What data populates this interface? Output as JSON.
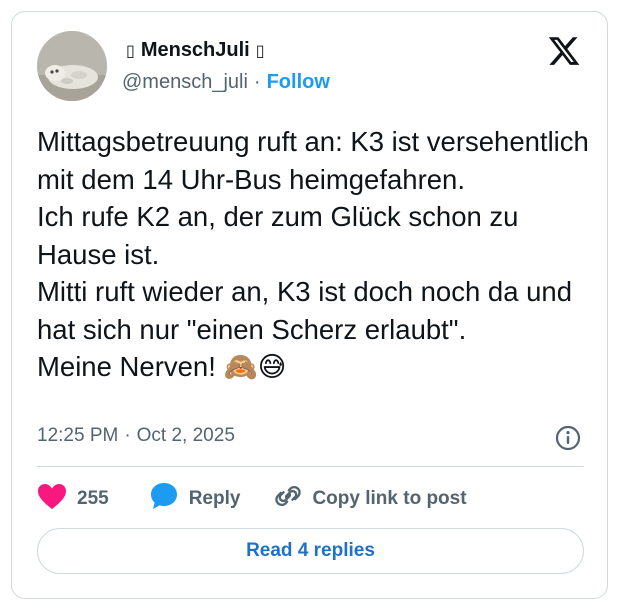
{
  "author": {
    "name": "MenschJuli",
    "name_prefix": "▯",
    "name_suffix": "▯",
    "handle": "@mensch_juli",
    "separator": "·",
    "follow_label": "Follow",
    "avatar": "seal-photo"
  },
  "brand": {
    "icon": "x-logo-icon"
  },
  "tweet": {
    "text": "Mittagsbetreuung ruft an: K3 ist versehentlich mit dem 14 Uhr-Bus heimgefahren.\nIch rufe K2 an, der zum Glück schon zu Hause ist.\nMitti ruft wieder an, K3 ist doch noch da und hat sich nur \"einen Scherz erlaubt\".\nMeine Nerven! 🙈😅",
    "time": "12:25 PM",
    "separator": "·",
    "date": "Oct 2, 2025"
  },
  "actions": {
    "like_count": "255",
    "reply_label": "Reply",
    "copy_label": "Copy link to post"
  },
  "footer": {
    "read_replies_label": "Read 4 replies"
  },
  "colors": {
    "accent": "#1d9bf0",
    "heart": "#f91880",
    "reply_bubble": "#1d9bf0",
    "border": "#cfd9de",
    "muted_text": "#536471"
  }
}
